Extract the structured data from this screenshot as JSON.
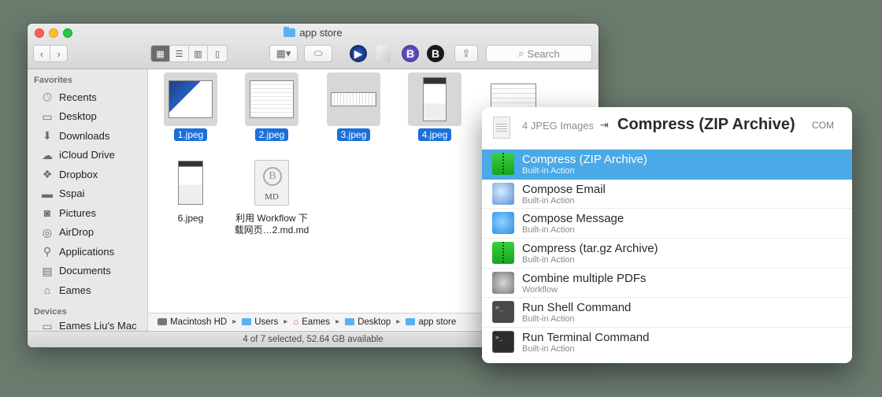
{
  "finder": {
    "title": "app store",
    "search_placeholder": "Search",
    "toolbar_icons": {
      "bookmark_b": "B",
      "bold_b": "B"
    },
    "sidebar": {
      "favorites_label": "Favorites",
      "items": [
        {
          "label": "Recents",
          "icon": "clock-icon"
        },
        {
          "label": "Desktop",
          "icon": "desktop-icon"
        },
        {
          "label": "Downloads",
          "icon": "downloads-icon"
        },
        {
          "label": "iCloud Drive",
          "icon": "cloud-icon"
        },
        {
          "label": "Dropbox",
          "icon": "dropbox-icon"
        },
        {
          "label": "Sspai",
          "icon": "folder-icon"
        },
        {
          "label": "Pictures",
          "icon": "camera-icon"
        },
        {
          "label": "AirDrop",
          "icon": "airdrop-icon"
        },
        {
          "label": "Applications",
          "icon": "applications-icon"
        },
        {
          "label": "Documents",
          "icon": "documents-icon"
        },
        {
          "label": "Eames",
          "icon": "home-icon"
        }
      ],
      "devices_label": "Devices",
      "device_item": "Eames Liu's Mac"
    },
    "files": [
      {
        "name": "1.jpeg",
        "selected": true
      },
      {
        "name": "2.jpeg",
        "selected": true
      },
      {
        "name": "3.jpeg",
        "selected": true
      },
      {
        "name": "4.jpeg",
        "selected": true
      },
      {
        "name": "6.jpeg",
        "selected": false
      },
      {
        "name": "利用 Workflow 下载网页…2.md.md",
        "selected": false,
        "line1": "利用 Workflow 下",
        "line2": "载网页…2.md.md",
        "doc_letter": "B",
        "doc_ext": "MD"
      }
    ],
    "path": [
      "Macintosh HD",
      "Users",
      "Eames",
      "Desktop",
      "app store"
    ],
    "status": "4 of 7 selected, 52.64 GB available"
  },
  "launchbar": {
    "subject": "4 JPEG Images",
    "arrow": "⇥",
    "action": "Compress (ZIP Archive)",
    "tag": "COM",
    "items": [
      {
        "title": "Compress (ZIP Archive)",
        "subtitle": "Built-in Action",
        "icon": "zip-archive-icon",
        "selected": true
      },
      {
        "title": "Compose Email",
        "subtitle": "Built-in Action",
        "icon": "mail-icon",
        "selected": false
      },
      {
        "title": "Compose Message",
        "subtitle": "Built-in Action",
        "icon": "messages-icon",
        "selected": false
      },
      {
        "title": "Compress (tar.gz Archive)",
        "subtitle": "Built-in Action",
        "icon": "tar-archive-icon",
        "selected": false
      },
      {
        "title": "Combine multiple PDFs",
        "subtitle": "Workflow",
        "icon": "workflow-icon",
        "selected": false
      },
      {
        "title": "Run Shell Command",
        "subtitle": "Built-in Action",
        "icon": "shell-icon",
        "selected": false
      },
      {
        "title": "Run Terminal Command",
        "subtitle": "Built-in Action",
        "icon": "terminal-icon",
        "selected": false
      }
    ]
  }
}
